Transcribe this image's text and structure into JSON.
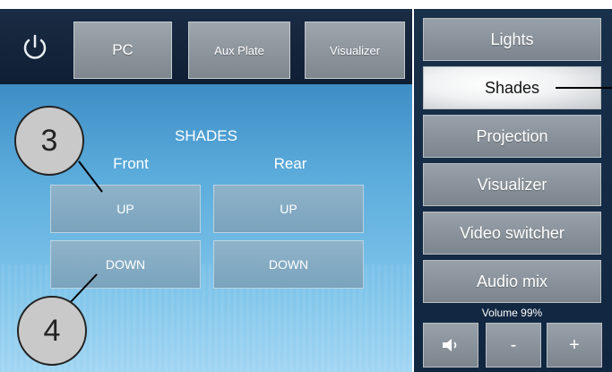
{
  "topbar": {
    "power_icon": "power-icon",
    "buttons": [
      "PC",
      "Aux Plate",
      "Visualizer"
    ]
  },
  "main": {
    "title": "SHADES",
    "front_label": "Front",
    "rear_label": "Rear",
    "front_up": "UP",
    "front_down": "DOWN",
    "rear_up": "UP",
    "rear_down": "DOWN"
  },
  "sidebar": {
    "items": [
      "Lights",
      "Shades",
      "Projection",
      "Visualizer",
      "Video switcher",
      "Audio mix"
    ],
    "active": "Shades"
  },
  "volume": {
    "label": "Volume  99%",
    "mute_icon": "speaker-icon",
    "minus": "-",
    "plus": "+"
  },
  "callouts": [
    "3",
    "4"
  ],
  "colors": {
    "dark_panel": "#112640",
    "blue_panel": "#5eaedd",
    "button_gray": "#8a9299",
    "active_button": "#f1f2f3"
  }
}
